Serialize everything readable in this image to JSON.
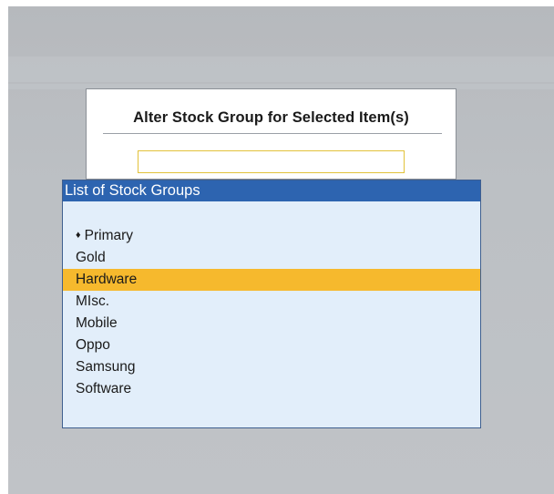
{
  "dialog": {
    "title": "Alter Stock Group for Selected Item(s)",
    "input_value": ""
  },
  "stock_group_list": {
    "header": "List of Stock Groups",
    "items": [
      {
        "label": "Primary",
        "bullet": "♦",
        "selected": false
      },
      {
        "label": "Gold",
        "bullet": "",
        "selected": false
      },
      {
        "label": "Hardware",
        "bullet": "",
        "selected": true
      },
      {
        "label": "MIsc.",
        "bullet": "",
        "selected": false
      },
      {
        "label": "Mobile",
        "bullet": "",
        "selected": false
      },
      {
        "label": "Oppo",
        "bullet": "",
        "selected": false
      },
      {
        "label": "Samsung",
        "bullet": "",
        "selected": false
      },
      {
        "label": "Software",
        "bullet": "",
        "selected": false
      }
    ]
  },
  "colors": {
    "header_background": "#2d64b0",
    "list_background": "#e2eefa",
    "selection_highlight": "#f6b92d",
    "input_border": "#e2c23a"
  }
}
